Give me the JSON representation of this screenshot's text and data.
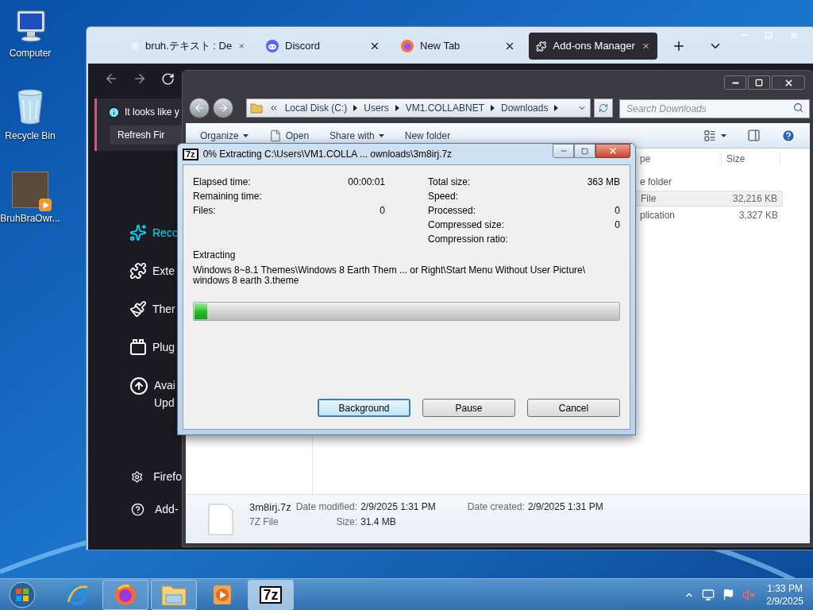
{
  "desktop_icons": [
    {
      "kind": "computer",
      "label": "Computer"
    },
    {
      "kind": "recycle",
      "label": "Recycle Bin"
    },
    {
      "kind": "video",
      "label": "BruhBraOwr..."
    }
  ],
  "browser": {
    "tabs": [
      {
        "kind": "landmark",
        "label": "bruh.テキスト : De",
        "selected": false
      },
      {
        "kind": "discord",
        "label": "Discord",
        "selected": false
      },
      {
        "kind": "firefox",
        "label": "New Tab",
        "selected": false
      },
      {
        "kind": "addons",
        "label": "Add-ons Manager",
        "selected": true
      }
    ],
    "notification": {
      "text": "It looks like y",
      "button": "Refresh Fir"
    },
    "sidebar": {
      "items": [
        {
          "kind": "recommendations",
          "label": "Reco",
          "selected": true
        },
        {
          "kind": "extensions",
          "label": "Exte",
          "selected": false
        },
        {
          "kind": "themes",
          "label": "Ther",
          "selected": false
        },
        {
          "kind": "plugins",
          "label": "Plug",
          "selected": false
        },
        {
          "kind": "updates",
          "label": "Avai\nUpd",
          "selected": false
        }
      ],
      "footer": [
        {
          "kind": "settings",
          "label": "Firefo"
        },
        {
          "kind": "help",
          "label": "Add-"
        }
      ]
    }
  },
  "explorer": {
    "breadcrumb": [
      "Local Disk (C:)",
      "Users",
      "VM1.COLLABNET",
      "Downloads"
    ],
    "search": {
      "placeholder": "Search Downloads"
    },
    "toolbar": [
      {
        "label": "Organize",
        "menu": true,
        "kind": "plain"
      },
      {
        "label": "Open",
        "menu": false,
        "kind": "file"
      },
      {
        "label": "Share with",
        "menu": true,
        "kind": "plain"
      },
      {
        "label": "New folder",
        "menu": false,
        "kind": "plain"
      }
    ],
    "columns": [
      "pe",
      "Size"
    ],
    "rows": [
      {
        "type": "e folder",
        "selected": false
      },
      {
        "type": "File",
        "size": "32,216 KB",
        "selected": true
      },
      {
        "type": "plication",
        "size": "3,327 KB",
        "selected": false
      }
    ],
    "details": {
      "name": "3m8irj.7z",
      "type": "7Z File",
      "fields": [
        {
          "label": "Date modified:",
          "value": "2/9/2025 1:31 PM"
        },
        {
          "label": "Size:",
          "value": "31.4 MB"
        },
        {
          "label": "Date created:",
          "value": "2/9/2025 1:31 PM"
        }
      ]
    }
  },
  "dialog": {
    "icon_label": "7z",
    "title": "0% Extracting C:\\Users\\VM1.COLLA ... ownloads\\3m8irj.7z",
    "stats_left": [
      {
        "label": "Elapsed time:",
        "value": "00:00:01"
      },
      {
        "label": "Remaining time:"
      },
      {
        "label": "Files:",
        "value": "0"
      }
    ],
    "stats_right": [
      {
        "label": "Total size:",
        "value": "363 MB"
      },
      {
        "label": "Speed:"
      },
      {
        "label": "Processed:",
        "value": "0"
      },
      {
        "label": "Compressed size:",
        "value": "0"
      },
      {
        "label": "Compression ratio:"
      }
    ],
    "status": "Extracting",
    "path_lines": [
      "Windows 8~8.1 Themes\\Windows 8 Earth Them ... or Right\\Start Menu Without User Picture\\",
      "windows 8 earth 3.theme"
    ],
    "progress": {
      "level": 0.03
    },
    "buttons": [
      {
        "label": "Background",
        "default": true
      },
      {
        "label": "Pause",
        "default": false
      },
      {
        "label": "Cancel",
        "default": false
      }
    ]
  },
  "taskbar": {
    "items": [
      {
        "kind": "ie",
        "open": false,
        "active": false
      },
      {
        "kind": "firefox",
        "open": true,
        "active": false
      },
      {
        "kind": "explorer",
        "open": true,
        "active": false
      },
      {
        "kind": "media",
        "open": false,
        "active": false
      },
      {
        "kind": "sevenzip",
        "open": true,
        "active": true,
        "icon_label": "7z"
      }
    ],
    "time": "1:33 PM",
    "date": "2/9/2025"
  }
}
